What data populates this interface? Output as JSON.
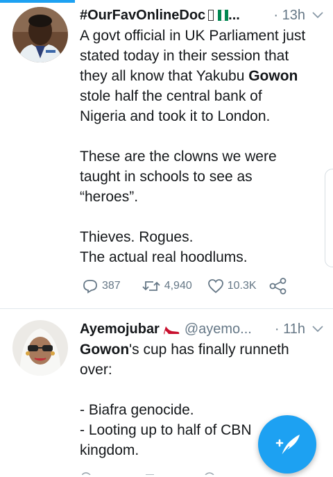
{
  "tweets": [
    {
      "display_name": "#OurFavOnlineDoc",
      "name_suffix": "...",
      "handle": "",
      "time": "· 13h",
      "text_lines": [
        {
          "runs": [
            {
              "t": "A govt official in UK Parliament just"
            }
          ]
        },
        {
          "runs": [
            {
              "t": "stated today in their session that"
            }
          ]
        },
        {
          "runs": [
            {
              "t": "they all know that Yakubu "
            },
            {
              "t": "Gowon",
              "b": true
            }
          ]
        },
        {
          "runs": [
            {
              "t": "stole half the central bank of"
            }
          ]
        },
        {
          "runs": [
            {
              "t": "Nigeria and took it to London."
            }
          ]
        },
        {
          "gap": true
        },
        {
          "runs": [
            {
              "t": "These are the clowns we were"
            }
          ]
        },
        {
          "runs": [
            {
              "t": "taught in schools to see as"
            }
          ]
        },
        {
          "runs": [
            {
              "t": "“heroes”."
            }
          ]
        },
        {
          "gap": true
        },
        {
          "runs": [
            {
              "t": "Thieves. Rogues."
            }
          ]
        },
        {
          "runs": [
            {
              "t": "The actual real hoodlums."
            }
          ]
        }
      ],
      "replies": "387",
      "retweets": "4,940",
      "likes": "10.3K"
    },
    {
      "display_name": "Ayemojubar",
      "handle": "@ayemo...",
      "time": "· 11h",
      "text_lines": [
        {
          "runs": [
            {
              "t": "Gowon",
              "b": true
            },
            {
              "t": "'s cup has finally runneth"
            }
          ]
        },
        {
          "runs": [
            {
              "t": "over:"
            }
          ]
        },
        {
          "gap": true
        },
        {
          "runs": [
            {
              "t": "- Biafra genocide."
            }
          ]
        },
        {
          "runs": [
            {
              "t": "- Looting up to half of CBN"
            }
          ]
        },
        {
          "runs": [
            {
              "t": "kingdom."
            }
          ]
        }
      ]
    }
  ],
  "icons": {
    "reply": "reply-icon",
    "retweet": "retweet-icon",
    "like": "heart-icon",
    "share": "share-icon",
    "compose": "compose-tweet-icon",
    "flag": "nigeria-flag-icon",
    "shoe": "high-heel-icon"
  },
  "colors": {
    "accent": "#1da1f2",
    "text": "#14171a",
    "secondary": "#657786",
    "flag_green": "#008751",
    "heel_red": "#c8102e"
  }
}
